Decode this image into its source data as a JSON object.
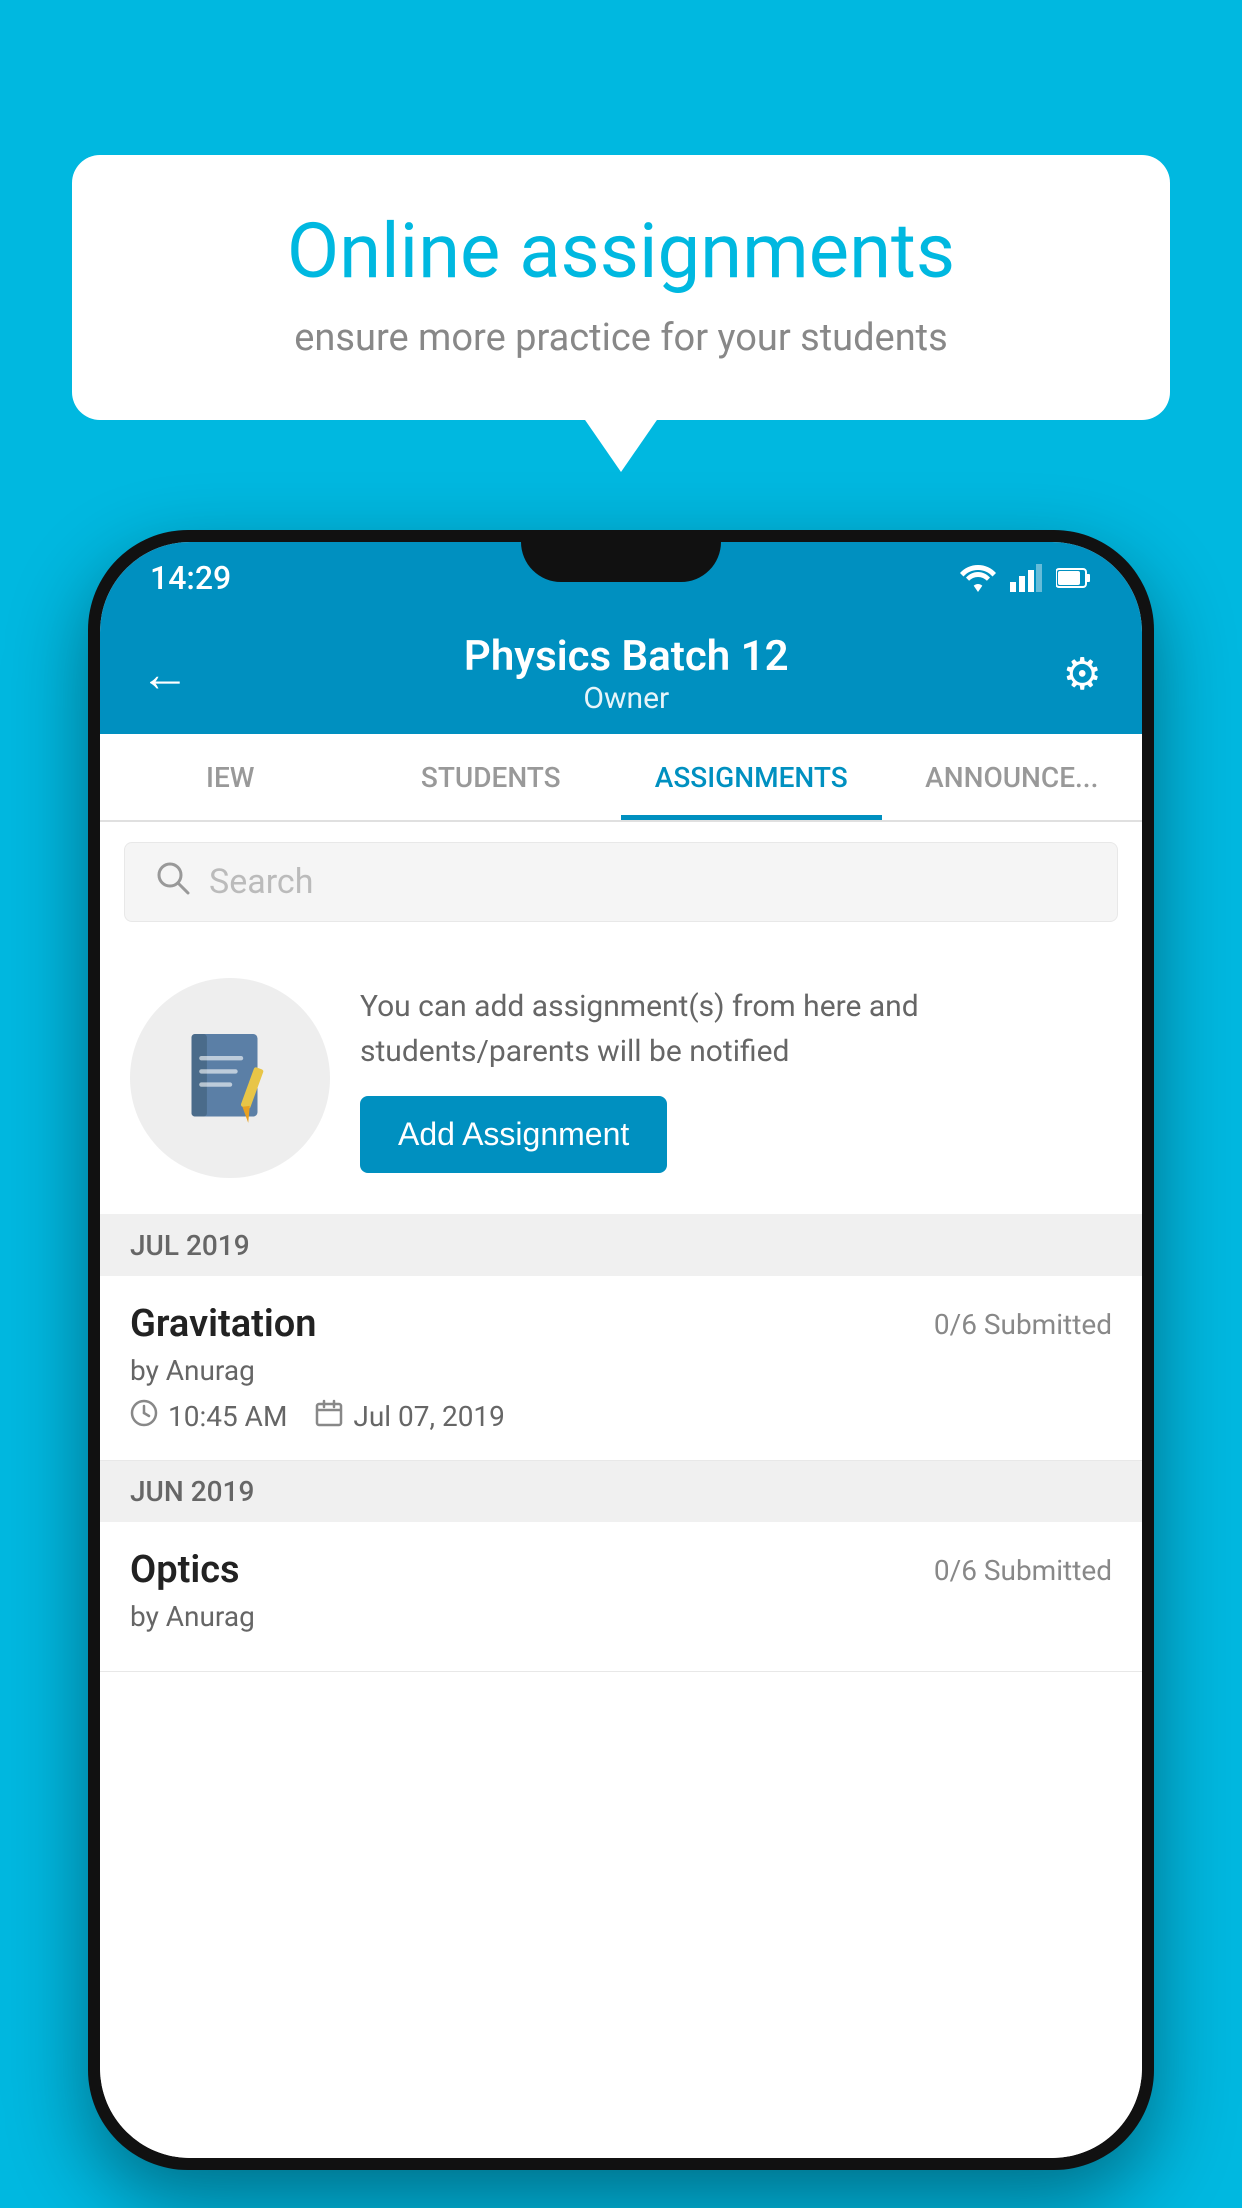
{
  "background": {
    "color": "#00b8e0"
  },
  "speech_bubble": {
    "title": "Online assignments",
    "subtitle": "ensure more practice for your students"
  },
  "status_bar": {
    "time": "14:29",
    "wifi_icon": "wifi",
    "signal_icon": "signal",
    "battery_icon": "battery"
  },
  "app_bar": {
    "title": "Physics Batch 12",
    "subtitle": "Owner",
    "back_label": "←",
    "settings_label": "⚙"
  },
  "tabs": [
    {
      "label": "IEW",
      "active": false
    },
    {
      "label": "STUDENTS",
      "active": false
    },
    {
      "label": "ASSIGNMENTS",
      "active": true
    },
    {
      "label": "ANNOUNCEMENTS",
      "active": false
    }
  ],
  "search": {
    "placeholder": "Search"
  },
  "add_assignment_section": {
    "description": "You can add assignment(s) from here and students/parents will be notified",
    "button_label": "Add Assignment"
  },
  "sections": [
    {
      "label": "JUL 2019",
      "assignments": [
        {
          "title": "Gravitation",
          "submitted": "0/6 Submitted",
          "by": "by Anurag",
          "time": "10:45 AM",
          "date": "Jul 07, 2019"
        }
      ]
    },
    {
      "label": "JUN 2019",
      "assignments": [
        {
          "title": "Optics",
          "submitted": "0/6 Submitted",
          "by": "by Anurag",
          "time": "",
          "date": ""
        }
      ]
    }
  ]
}
